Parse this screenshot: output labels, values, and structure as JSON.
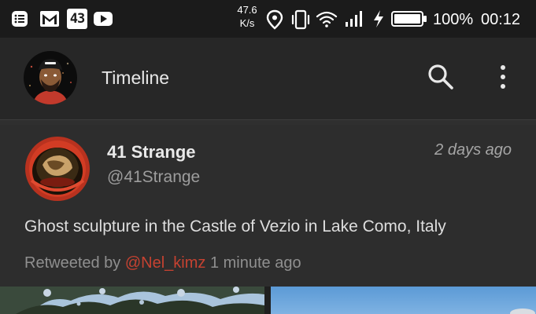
{
  "status_bar": {
    "net_speed_value": "47.6",
    "net_speed_unit": "K/s",
    "notification_badge": "43",
    "battery_percent": "100%",
    "clock": "00:12",
    "icons": [
      "messages-icon",
      "gmail-icon",
      "badge-43-icon",
      "youtube-icon",
      "location-icon",
      "vibrate-icon",
      "wifi-icon",
      "signal-icon",
      "charging-icon",
      "battery-icon"
    ]
  },
  "app_bar": {
    "title": "Timeline",
    "icons": [
      "avatar",
      "search-icon",
      "overflow-menu-icon"
    ]
  },
  "tweet": {
    "author_name": "41 Strange",
    "author_handle": "@41Strange",
    "time": "2 days ago",
    "text": "Ghost sculpture in the Castle of Vezio in Lake Como, Italy",
    "retweet_prefix": "Retweeted by",
    "retweeter": "@Nel_kimz",
    "retweet_time": "1 minute ago"
  },
  "colors": {
    "background": "#1f1f1f",
    "app_bar": "#272727",
    "card": "#2d2d2d",
    "accent": "#c64231"
  }
}
